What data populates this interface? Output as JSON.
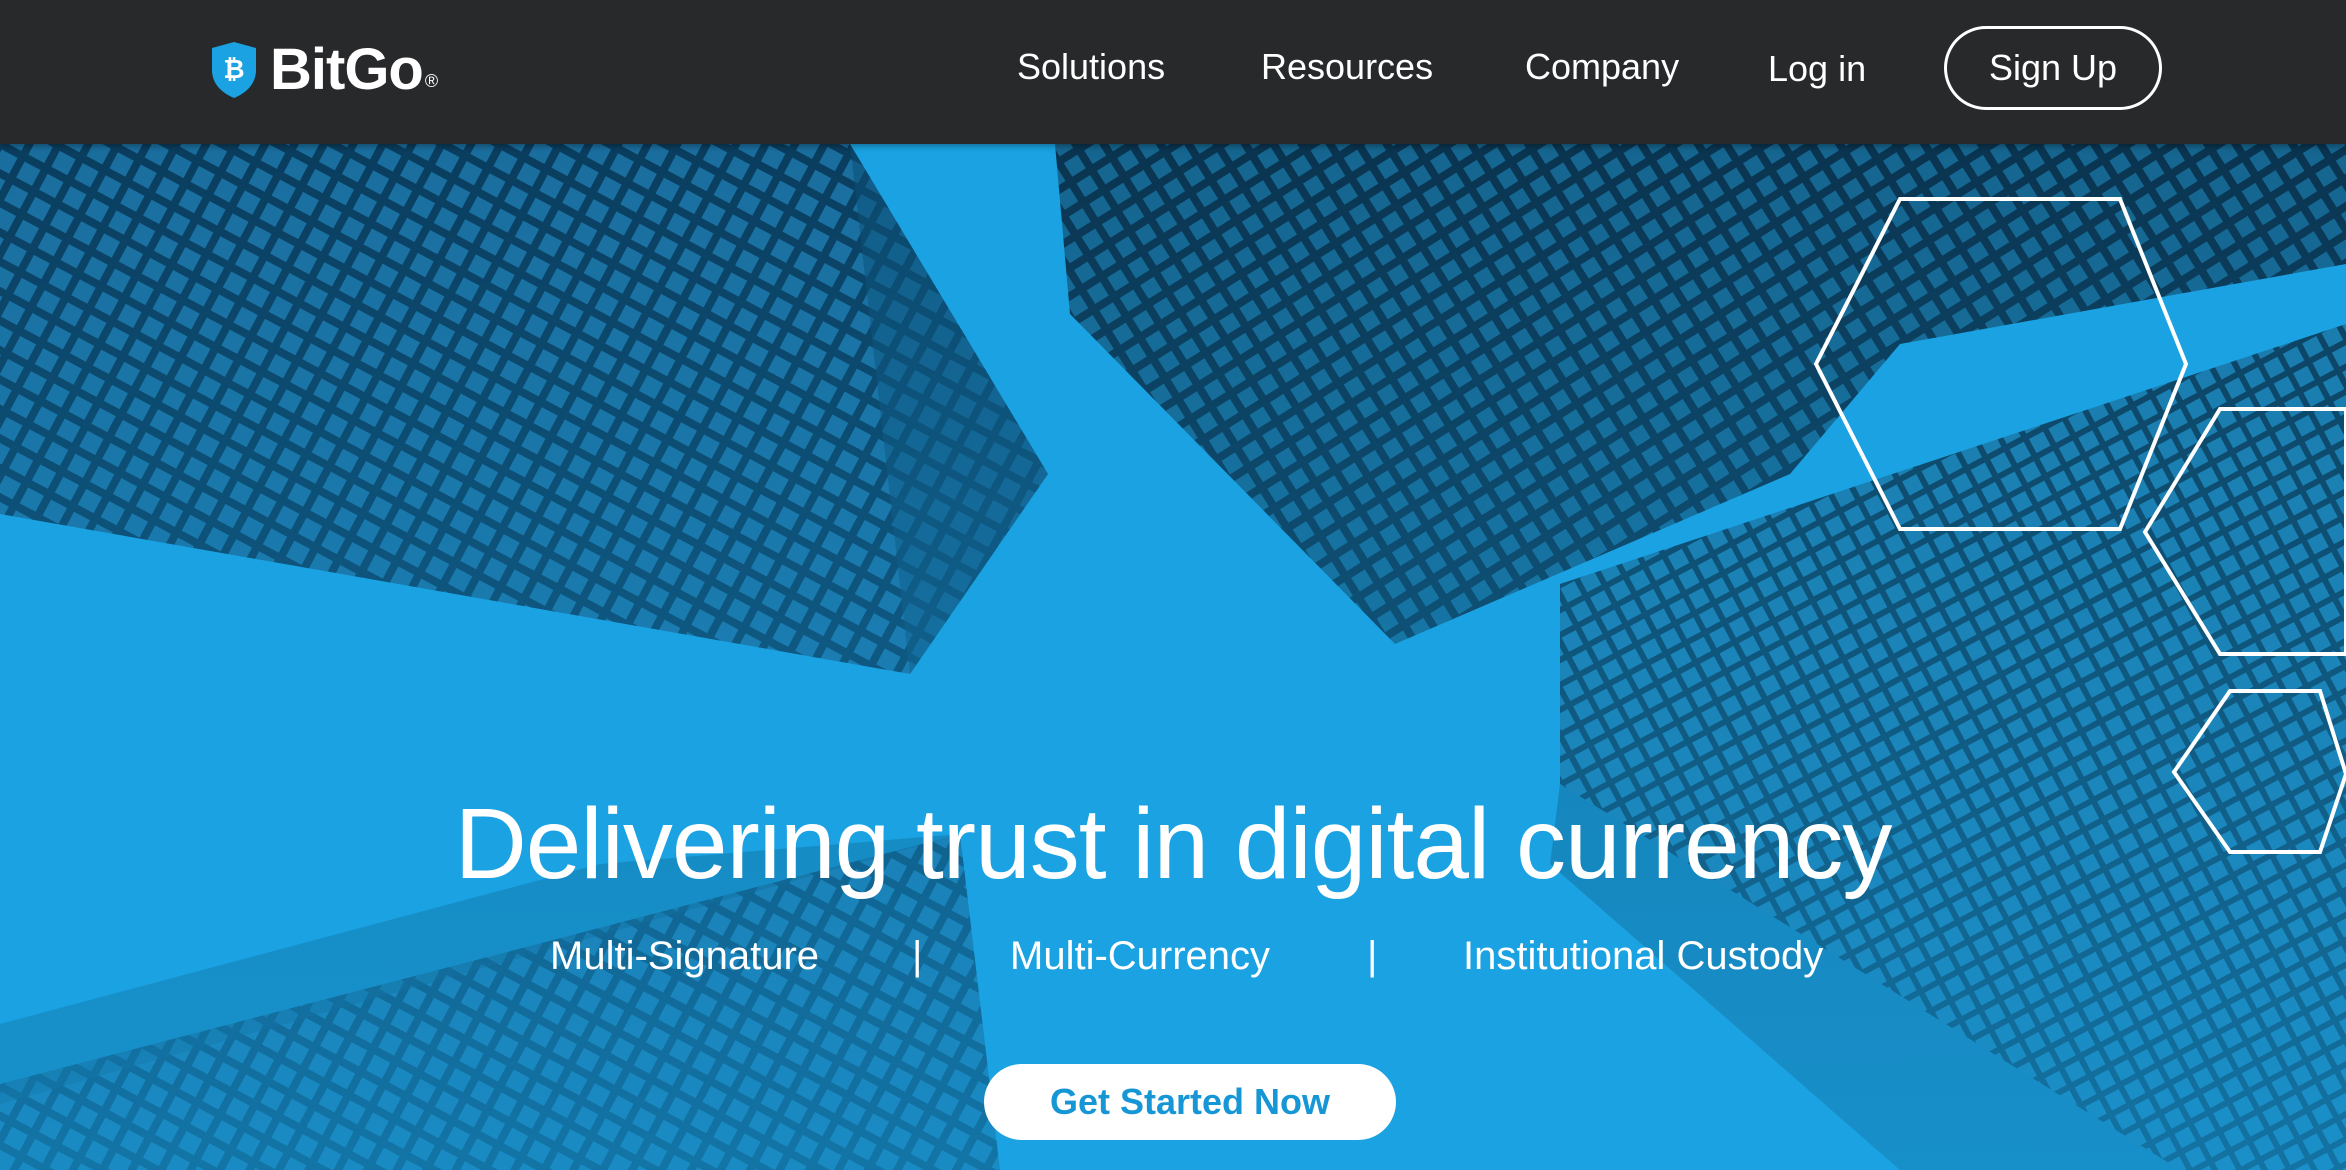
{
  "brand": {
    "name": "BitGo",
    "reg_mark": "®",
    "shield_glyph": "₿",
    "accent": "#1aa2e2"
  },
  "nav": {
    "items": [
      {
        "label": "Solutions"
      },
      {
        "label": "Resources"
      },
      {
        "label": "Company"
      }
    ],
    "login_label": "Log in",
    "signup_label": "Sign Up"
  },
  "hero": {
    "headline": "Delivering trust in digital currency",
    "features": [
      "Multi-Signature",
      "Multi-Currency",
      "Institutional Custody"
    ],
    "separator": "|",
    "cta_label": "Get Started Now"
  }
}
